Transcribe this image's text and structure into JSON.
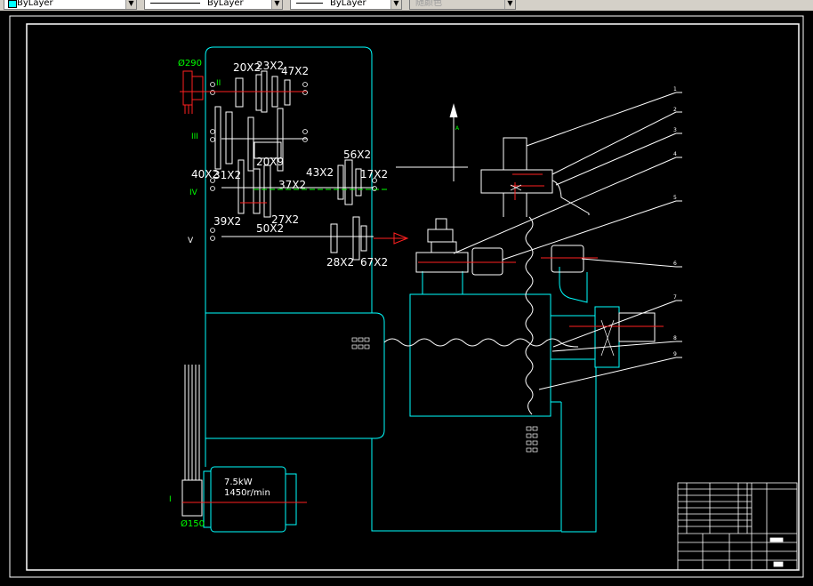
{
  "toolbar": {
    "color_combo": {
      "value": "ByLayer",
      "swatch_color": "#00ffff"
    },
    "linetype_combo": {
      "value": "ByLayer"
    },
    "lineweight_combo": {
      "value": "ByLayer"
    },
    "plotstyle_combo": {
      "value": "随颜色"
    }
  },
  "drawing": {
    "gears": {
      "g20x2": "20X2",
      "g23x2": "23X2",
      "g47x2": "47X2",
      "g20x9": "20X9",
      "g40x2": "40X2",
      "g31x2": "31X2",
      "g43x2": "43X2",
      "g56x2": "56X2",
      "g17x2": "17X2",
      "g37x2": "37X2",
      "g39x2": "39X2",
      "g27x2": "27X2",
      "g50x2": "50X2",
      "g28x2": "28X2",
      "g67x2": "67X2"
    },
    "shafts": {
      "s2": "II",
      "s3": "III",
      "s4": "IV",
      "s5": "V",
      "s1": "I"
    },
    "pulley_top": "Ø290",
    "pulley_bottom": "Ø150",
    "motor_power": "7.5kW",
    "motor_speed": "1450r/min",
    "callouts": [
      "1",
      "2",
      "3",
      "4",
      "5",
      "6",
      "7",
      "8",
      "9"
    ],
    "arrow_label": "A",
    "colors": {
      "frame": "#ffffff",
      "housing": "#00ffff",
      "gear": "#ffffff",
      "axis": "#ff2020",
      "shaft_label": "#00ff00",
      "pulley": "#ff2020"
    }
  }
}
